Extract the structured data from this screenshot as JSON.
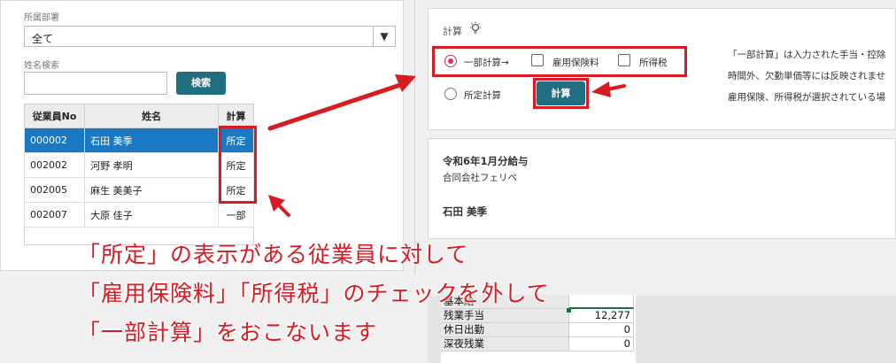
{
  "left": {
    "dept_label": "所属部署",
    "dept_value": "全て",
    "dept_arrow": "▼",
    "name_search_label": "姓名検索",
    "search_button": "検索",
    "table": {
      "headers": [
        "従業員No",
        "姓名",
        "計算"
      ],
      "rows": [
        {
          "no": "000002",
          "name": "石田 美季",
          "calc": "所定"
        },
        {
          "no": "002002",
          "name": "河野 孝明",
          "calc": "所定"
        },
        {
          "no": "002005",
          "name": "麻生 美美子",
          "calc": "所定"
        },
        {
          "no": "002007",
          "name": "大原 佳子",
          "calc": "一部"
        }
      ]
    }
  },
  "calc": {
    "title": "計算",
    "icon": "lightbulb-icon",
    "partial_label": "一部計算→",
    "employment_insurance_label": "雇用保険料",
    "income_tax_label": "所得税",
    "fixed_label": "所定計算",
    "calc_button": "計算",
    "notes": [
      "「一部計算」は入力された手当・控除",
      "時間外、欠勤単価等には反映されませ",
      "雇用保険、所得税が選択されている場"
    ]
  },
  "payslip": {
    "title": "令和6年1月分給与",
    "company": "合同会社フェリペ",
    "employee": "石田 美季"
  },
  "sheet": {
    "rows": [
      {
        "label": "基本給",
        "value": ""
      },
      {
        "label": "残業手当",
        "value": "12,277"
      },
      {
        "label": "休日出勤",
        "value": "0"
      },
      {
        "label": "深夜残業",
        "value": "0"
      }
    ]
  },
  "annotation": {
    "line1": "「所定」の表示がある従業員に対して",
    "line2": "「雇用保険料」「所得税」のチェックを外して",
    "line3": "「一部計算」をおこないます"
  },
  "colors": {
    "accent_red": "#d81b22",
    "teal": "#1f6f81",
    "selected_blue": "#1a79c2",
    "radio_pink": "#d9345a"
  }
}
